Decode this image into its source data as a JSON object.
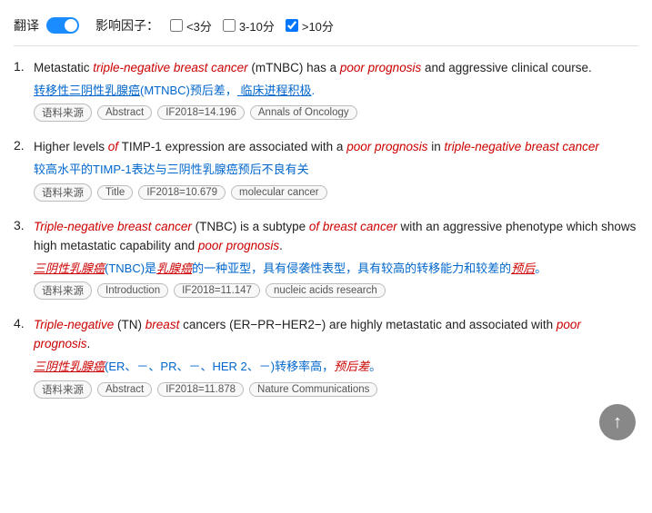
{
  "topBar": {
    "translateLabel": "翻译",
    "toggleOn": true,
    "impactLabel": "影响因子：",
    "filters": [
      {
        "label": "<3分",
        "checked": false
      },
      {
        "label": "3-10分",
        "checked": false
      },
      {
        "label": ">10分",
        "checked": true
      }
    ]
  },
  "results": [
    {
      "number": "1.",
      "enParts": [
        {
          "text": "Metastatic ",
          "style": "normal"
        },
        {
          "text": "triple-negative breast cancer",
          "style": "italic-red"
        },
        {
          "text": " (mTNBC) has a ",
          "style": "normal"
        },
        {
          "text": "poor prognosis",
          "style": "italic-red"
        },
        {
          "text": " and aggressive clinical course.",
          "style": "normal"
        }
      ],
      "zhParts": [
        {
          "text": "转移性三阴性乳腺癌",
          "style": "zh-underline"
        },
        {
          "text": "(MTNBC)",
          "style": "plain"
        },
        {
          "text": "预后差，",
          "style": "plain"
        },
        {
          "text": " 临床进程积极",
          "style": "zh-underline"
        },
        {
          "text": ".",
          "style": "plain"
        }
      ],
      "tags": [
        "语料来源",
        "Abstract",
        "IF2018=14.196",
        "Annals of Oncology"
      ]
    },
    {
      "number": "2.",
      "enParts": [
        {
          "text": "Higher levels ",
          "style": "normal"
        },
        {
          "text": "of",
          "style": "italic-red"
        },
        {
          "text": " TIMP-1 expression are associated with a ",
          "style": "normal"
        },
        {
          "text": "poor prognosis",
          "style": "italic-red"
        },
        {
          "text": " in ",
          "style": "normal"
        },
        {
          "text": "triple-negative breast cancer",
          "style": "italic-red"
        }
      ],
      "zhParts": [
        {
          "text": "较高水平的TIMP-1表达与三阴性乳腺癌预后不良有关",
          "style": "plain"
        }
      ],
      "tags": [
        "语料来源",
        "Title",
        "IF2018=10.679",
        "molecular cancer"
      ]
    },
    {
      "number": "3.",
      "enParts": [
        {
          "text": "Triple-negative breast cancer",
          "style": "italic-red"
        },
        {
          "text": " (TNBC) is a subtype ",
          "style": "normal"
        },
        {
          "text": "of breast cancer",
          "style": "italic-red"
        },
        {
          "text": " with an aggressive phenotype which shows high metastatic capability and ",
          "style": "normal"
        },
        {
          "text": "poor prognosis",
          "style": "italic-red"
        },
        {
          "text": ".",
          "style": "normal"
        }
      ],
      "zhParts": [
        {
          "text": "三阴性乳腺癌",
          "style": "zh-red-underline"
        },
        {
          "text": "(TNBC)是",
          "style": "plain"
        },
        {
          "text": "乳腺癌",
          "style": "zh-red-underline"
        },
        {
          "text": "的一种亚型，具有侵袭性表型，具有较高的转移能力和较差的",
          "style": "plain"
        },
        {
          "text": "预后",
          "style": "zh-red-underline"
        },
        {
          "text": "。",
          "style": "plain"
        }
      ],
      "tags": [
        "语料来源",
        "Introduction",
        "IF2018=11.147",
        "nucleic acids research"
      ]
    },
    {
      "number": "4.",
      "enParts": [
        {
          "text": "Triple-negative",
          "style": "italic-red"
        },
        {
          "text": " (TN) ",
          "style": "normal"
        },
        {
          "text": "breast",
          "style": "italic-red"
        },
        {
          "text": " cancers (ER−PR−HER2−) are highly metastatic and associated with ",
          "style": "normal"
        },
        {
          "text": "poor prognosis",
          "style": "italic-red"
        },
        {
          "text": ".",
          "style": "normal"
        }
      ],
      "zhParts": [
        {
          "text": "三阴性乳腺癌",
          "style": "zh-red-underline"
        },
        {
          "text": "(ER、－、PR、－、HER 2、－)转移率高，",
          "style": "plain"
        },
        {
          "text": "预后差",
          "style": "zh-red"
        },
        {
          "text": "。",
          "style": "plain"
        }
      ],
      "tags": [
        "语料来源",
        "Abstract",
        "IF2018=11.878",
        "Nature Communications"
      ]
    }
  ],
  "scrollTopBtn": "↑"
}
